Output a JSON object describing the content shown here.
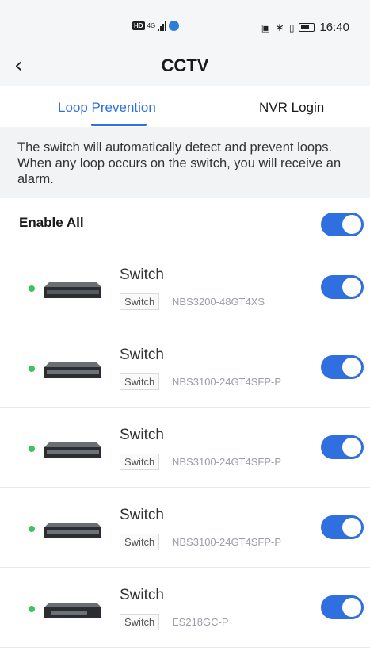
{
  "status_bar": {
    "hd": "HD",
    "network": "4G",
    "time": "16:40"
  },
  "nav": {
    "title": "CCTV",
    "back_icon": "chevron-left-icon"
  },
  "tabs": [
    {
      "label": "Loop Prevention",
      "active": true
    },
    {
      "label": "NVR Login",
      "active": false
    }
  ],
  "notice": "The switch will automatically detect and prevent loops. When any loop occurs on the switch, you will receive an alarm.",
  "enable_all": {
    "label": "Enable All",
    "on": true
  },
  "devices": [
    {
      "name": "Switch",
      "type": "Switch",
      "model": "NBS3200-48GT4XS",
      "online": true,
      "enabled": true
    },
    {
      "name": "Switch",
      "type": "Switch",
      "model": "NBS3100-24GT4SFP-P",
      "online": true,
      "enabled": true
    },
    {
      "name": "Switch",
      "type": "Switch",
      "model": "NBS3100-24GT4SFP-P",
      "online": true,
      "enabled": true
    },
    {
      "name": "Switch",
      "type": "Switch",
      "model": "NBS3100-24GT4SFP-P",
      "online": true,
      "enabled": true
    },
    {
      "name": "Switch",
      "type": "Switch",
      "model": "ES218GC-P",
      "online": true,
      "enabled": true
    }
  ],
  "colors": {
    "accent": "#2f6fe0",
    "online": "#3cc35a"
  }
}
